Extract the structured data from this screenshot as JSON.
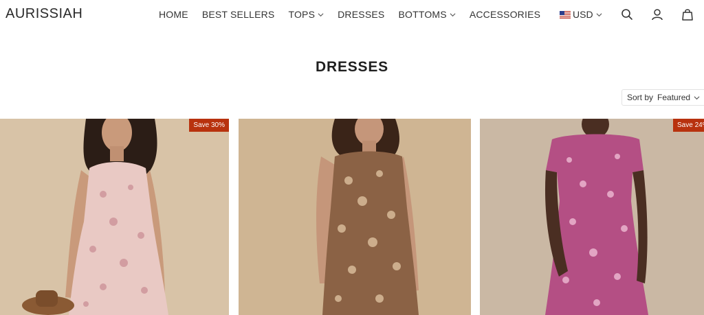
{
  "header": {
    "logo": "AURISSIAH",
    "nav": [
      {
        "label": "HOME",
        "has_dropdown": false
      },
      {
        "label": "BEST SELLERS",
        "has_dropdown": false
      },
      {
        "label": "TOPS",
        "has_dropdown": true
      },
      {
        "label": "DRESSES",
        "has_dropdown": false
      },
      {
        "label": "BOTTOMS",
        "has_dropdown": true
      },
      {
        "label": "ACCESSORIES",
        "has_dropdown": false
      }
    ],
    "currency": {
      "label": "USD",
      "flag": "us-flag-icon"
    },
    "icons": [
      "search-icon",
      "account-icon",
      "cart-icon"
    ]
  },
  "page": {
    "title": "DRESSES",
    "sort": {
      "label": "Sort by",
      "value": "Featured"
    }
  },
  "products": [
    {
      "badge": "Save 30%",
      "dress_color": "#e9c9c4",
      "print_color": "#c98e96",
      "background": "#d8c3a7"
    },
    {
      "badge": "",
      "dress_color": "#8b6245",
      "print_color": "#e2c7a4",
      "background": "#cfb593"
    },
    {
      "badge": "Save 24%",
      "dress_color": "#b44f84",
      "print_color": "#f1c2d8",
      "background": "#cab8a4"
    }
  ],
  "colors": {
    "badge": "#b8320e",
    "text": "#222222"
  }
}
